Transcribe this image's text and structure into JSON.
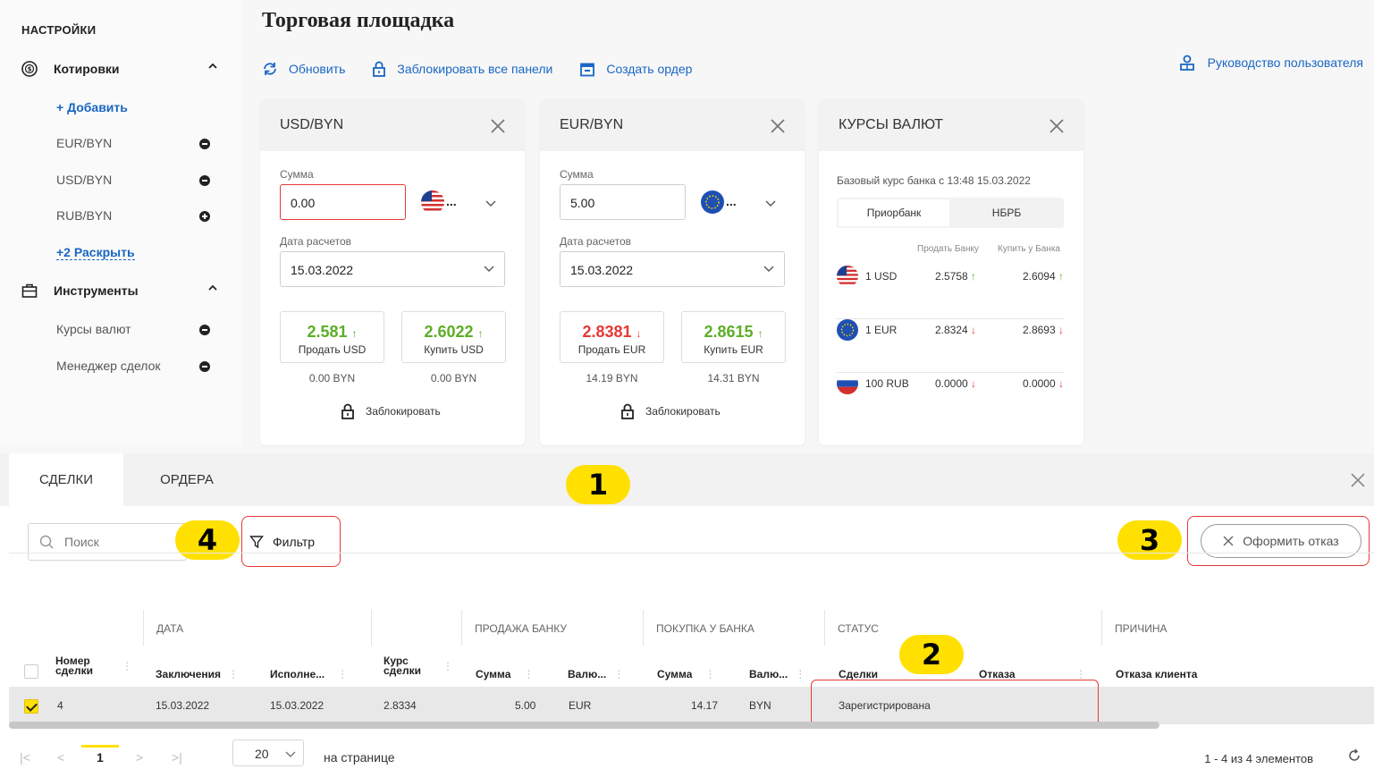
{
  "sidebar": {
    "title": "НАСТРОЙКИ",
    "quotes": {
      "label": "Котировки",
      "add": "+ Добавить",
      "items": [
        "EUR/BYN",
        "USD/BYN",
        "RUB/BYN"
      ],
      "expand": "+2 Раскрыть"
    },
    "tools": {
      "label": "Инструменты",
      "items": [
        "Курсы валют",
        "Менеджер сделок"
      ]
    }
  },
  "header": {
    "title": "Торговая площадка",
    "refresh": "Обновить",
    "lock_all": "Заблокировать все панели",
    "create_order": "Создать ордер",
    "guide": "Руководство пользователя"
  },
  "card_usd": {
    "title": "USD/BYN",
    "amount_label": "Сумма",
    "amount": "0.00",
    "date_label": "Дата расчетов",
    "date": "15.03.2022",
    "sell_value": "2.581",
    "sell_label": "Продать USD",
    "sell_sum": "0.00 BYN",
    "buy_value": "2.6022",
    "buy_label": "Купить USD",
    "buy_sum": "0.00 BYN",
    "lock": "Заблокировать",
    "flag_dots": "..."
  },
  "card_eur": {
    "title": "EUR/BYN",
    "amount_label": "Сумма",
    "amount": "5.00",
    "date_label": "Дата расчетов",
    "date": "15.03.2022",
    "sell_value": "2.8381",
    "sell_label": "Продать EUR",
    "sell_sum": "14.19 BYN",
    "buy_value": "2.8615",
    "buy_label": "Купить EUR",
    "buy_sum": "14.31 BYN",
    "lock": "Заблокировать",
    "flag_dots": "..."
  },
  "rates_card": {
    "title": "КУРСЫ ВАЛЮТ",
    "base": "Базовый курс банка с 13:48 15.03.2022",
    "seg_left": "Приорбанк",
    "seg_right": "НБРБ",
    "col_sell": "Продать Банку",
    "col_buy": "Купить у Банка",
    "rows": [
      {
        "cur": "1 USD",
        "sell": "2.5758",
        "buy": "2.6094"
      },
      {
        "cur": "1 EUR",
        "sell": "2.8324",
        "buy": "2.8693"
      },
      {
        "cur": "100 RUB",
        "sell": "0.0000",
        "buy": "0.0000"
      }
    ]
  },
  "panel": {
    "tab_deals": "СДЕЛКИ",
    "tab_orders": "ОРДЕРА",
    "search_placeholder": "Поиск",
    "filter": "Фильтр",
    "refuse": "Оформить отказ",
    "badges": [
      "1",
      "2",
      "3",
      "4"
    ]
  },
  "table": {
    "groups": {
      "date": "ДАТА",
      "sell": "ПРОДАЖА БАНКУ",
      "buy": "ПОКУПКА У БАНКА",
      "status": "СТАТУС",
      "reason": "ПРИЧИНА"
    },
    "cols": {
      "num": "Номер сделки",
      "concluded": "Заключения",
      "executed": "Исполне...",
      "rate": "Курс сделки",
      "sell_sum": "Сумма",
      "sell_cur": "Валю...",
      "buy_sum": "Сумма",
      "buy_cur": "Валю...",
      "status_deal": "Сделки",
      "status_refuse": "Отказа",
      "reason": "Отказа клиента"
    },
    "row": {
      "num": "4",
      "concluded": "15.03.2022",
      "executed": "15.03.2022",
      "rate": "2.8334",
      "sell_sum": "5.00",
      "sell_cur": "EUR",
      "buy_sum": "14.17",
      "buy_cur": "BYN",
      "status": "Зарегистрирована"
    }
  },
  "pager": {
    "page": "1",
    "per_page": "20",
    "per_label": "на странице",
    "total": "1 - 4 из 4 элементов"
  },
  "colors": {
    "accent": "#1a66c4",
    "green": "#5cae26",
    "red": "#e53935",
    "badge": "#ffe000"
  }
}
